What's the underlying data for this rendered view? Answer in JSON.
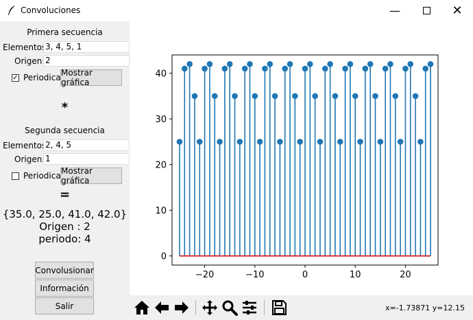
{
  "window": {
    "title": "Convoluciones"
  },
  "seq1": {
    "heading": "Primera secuencia",
    "elements_label": "Elementos:",
    "elements_value": "3, 4, 5, 1",
    "origin_label": "Origen:",
    "origin_value": "2",
    "periodic_label": "Periodica",
    "periodic_checked": true,
    "show_button": "Mostrar gráfica"
  },
  "operator": "*",
  "seq2": {
    "heading": "Segunda secuencia",
    "elements_label": "Elementos:",
    "elements_value": "2, 4, 5",
    "origin_label": "Origen:",
    "origin_value": "1",
    "periodic_label": "Periodica",
    "periodic_checked": false,
    "show_button": "Mostrar gráfica"
  },
  "equals": "=",
  "result": {
    "values": "{35.0, 25.0, 41.0, 42.0}",
    "origin": "Origen : 2",
    "period": "periodo: 4"
  },
  "buttons": {
    "convolve": "Convolusionar",
    "info": "Información",
    "exit": "Salir"
  },
  "toolbar": {
    "coords": "x=-1.73871     y=12.15"
  },
  "chart_data": {
    "type": "stem",
    "x_start": -25,
    "x_end": 25,
    "period_values": [
      35,
      25,
      41,
      42
    ],
    "period_origin_x": -2,
    "x_ticks": [
      "−20",
      "−10",
      "0",
      "10",
      "20"
    ],
    "y_ticks": [
      "0",
      "10",
      "20",
      "30",
      "40"
    ],
    "xlim": [
      -26.5,
      26.5
    ],
    "ylim": [
      -2,
      44
    ],
    "stem_color": "#1f77b4",
    "baseline_color": "#d62728"
  }
}
